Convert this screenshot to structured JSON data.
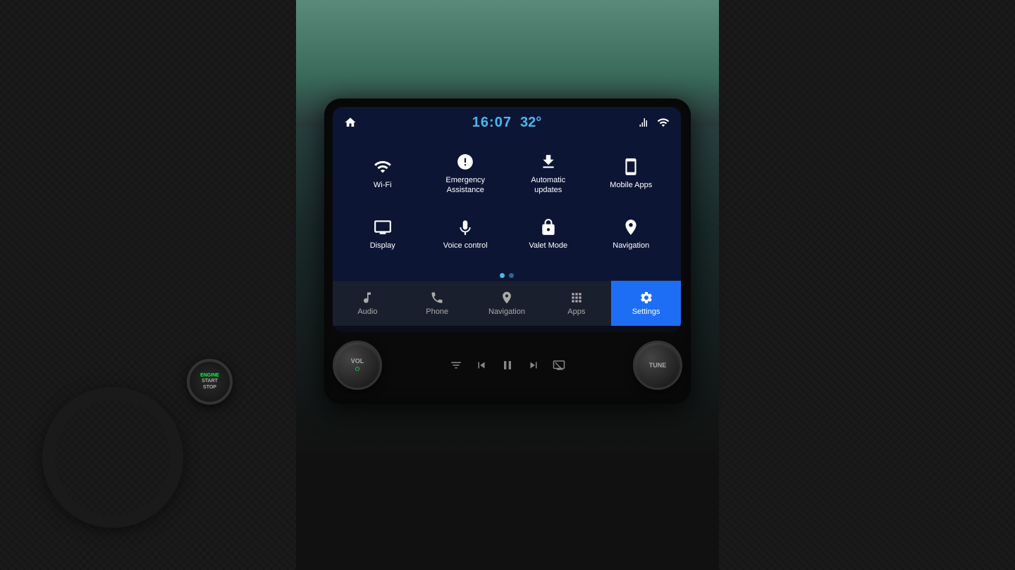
{
  "header": {
    "time": "16:07",
    "temperature": "32°",
    "home_icon": "home-icon",
    "signal_icon": "signal-icon",
    "wifi_icon": "wifi-icon"
  },
  "menu_grid": {
    "items": [
      {
        "id": "wifi",
        "label": "Wi-Fi",
        "icon": "wifi"
      },
      {
        "id": "emergency",
        "label": "Emergency\nAssistance",
        "icon": "emergency"
      },
      {
        "id": "updates",
        "label": "Automatic\nupdates",
        "icon": "download"
      },
      {
        "id": "mobile_apps",
        "label": "Mobile Apps",
        "icon": "mobile"
      },
      {
        "id": "display",
        "label": "Display",
        "icon": "display"
      },
      {
        "id": "voice",
        "label": "Voice control",
        "icon": "voice"
      },
      {
        "id": "valet",
        "label": "Valet Mode",
        "icon": "valet"
      },
      {
        "id": "navigation",
        "label": "Navigation",
        "icon": "navigation"
      }
    ]
  },
  "pagination": {
    "dots": [
      {
        "active": true
      },
      {
        "active": false
      }
    ]
  },
  "bottom_nav": {
    "tabs": [
      {
        "id": "audio",
        "label": "Audio",
        "icon": "audio",
        "active": false
      },
      {
        "id": "phone",
        "label": "Phone",
        "icon": "phone",
        "active": false
      },
      {
        "id": "navigation",
        "label": "Navigation",
        "icon": "nav",
        "active": false
      },
      {
        "id": "apps",
        "label": "Apps",
        "icon": "apps",
        "active": false
      },
      {
        "id": "settings",
        "label": "Settings",
        "icon": "settings",
        "active": true
      }
    ]
  },
  "controls": {
    "vol_label": "VOL",
    "tune_label": "TUNE"
  },
  "start_stop": {
    "engine_label": "ENGINE",
    "start_label": "START",
    "stop_label": "STOP"
  }
}
